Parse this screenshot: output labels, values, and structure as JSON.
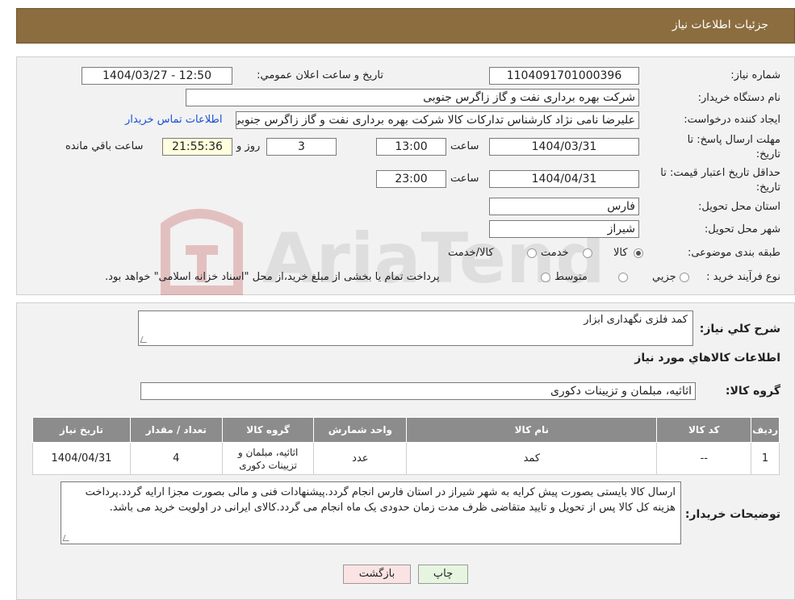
{
  "header": {
    "title": "جزئیات اطلاعات نیاز"
  },
  "form": {
    "need_number_label": "شماره نیاز:",
    "need_number": "1104091701000396",
    "announce_label": "تاريخ و ساعت اعلان عمومي:",
    "announce_value": "1404/03/27 - 12:50",
    "buyer_label": "نام دستگاه خريدار:",
    "buyer_value": "شرکت بهره برداری نفت و گاز زاگرس جنوبی",
    "creator_label": "ايجاد کننده درخواست:",
    "creator_value": "علیرضا نامی نژاد کارشناس تداركات كالا شركت بهره برداری نفت و گاز زاگرس جنوبی",
    "contact_link": "اطلاعات تماس خريدار",
    "deadline_label_1": "مهلت ارسال پاسخ: تا",
    "deadline_label_2": "تاريخ:",
    "deadline_date": "1404/03/31",
    "time_label": "ساعت",
    "deadline_time": "13:00",
    "days_value": "3",
    "days_label": "روز و",
    "remaining_time": "21:55:36",
    "remaining_label": "ساعت باقي مانده",
    "validity_label_1": "حداقل تاريخ اعتبار قيمت: تا",
    "validity_label_2": "تاريخ:",
    "validity_date": "1404/04/31",
    "validity_time": "23:00",
    "province_label": "استان محل تحويل:",
    "province_value": "فارس",
    "city_label": "شهر محل تحويل:",
    "city_value": "شیراز",
    "category_label": "طبقه بندی موضوعی:",
    "category_options": [
      "کالا",
      "خدمت",
      "کالا/خدمت"
    ],
    "category_selected": "کالا",
    "process_label": "نوع فرآيند خريد :",
    "process_options": [
      "جزيي",
      "متوسط"
    ],
    "process_note": "پرداخت تمام يا بخشی از مبلغ خريد،از محل \"اسناد خزانه اسلامی\" خواهد بود."
  },
  "summary": {
    "general_label": "شرح كلي نياز:",
    "general_value": "کمد فلزی نگهداری ابزار",
    "items_title": "اطلاعات كالاهاي مورد نياز",
    "group_label": "گروه كالا:",
    "group_value": "اثاثیه، مبلمان و تزیینات دکوری"
  },
  "table": {
    "headers": [
      "رديف",
      "کد کالا",
      "نام کالا",
      "واحد شمارش",
      "گروه کالا",
      "تعداد / مقدار",
      "تاريخ نياز"
    ],
    "rows": [
      [
        "1",
        "--",
        "کمد",
        "عدد",
        "اثاثیه، مبلمان و تزیینات دکوری",
        "4",
        "1404/04/31"
      ]
    ]
  },
  "notes": {
    "label": "توضيحات خريدار:",
    "text": "ارسال کالا بایستی بصورت پیش کرایه به شهر شیراز در استان فارس انجام گردد.پیشنهادات فنی و مالی بصورت مجزا ارایه گردد.پرداخت هزینه کل کالا پس از تحویل و تایید متقاضی ظرف مدت زمان حدودی یک ماه انجام می گردد.کالای ایرانی در اولویت خرید می باشد."
  },
  "buttons": {
    "print": "چاپ",
    "back": "بازگشت"
  },
  "colors": {
    "header_bg": "#8c6d3f",
    "table_header_bg": "#8c8c8c",
    "back_bg": "#fbe3e3",
    "print_bg": "#e6f5e0",
    "link": "#1a4fd6"
  },
  "watermark_text": "AriaTender.neT"
}
